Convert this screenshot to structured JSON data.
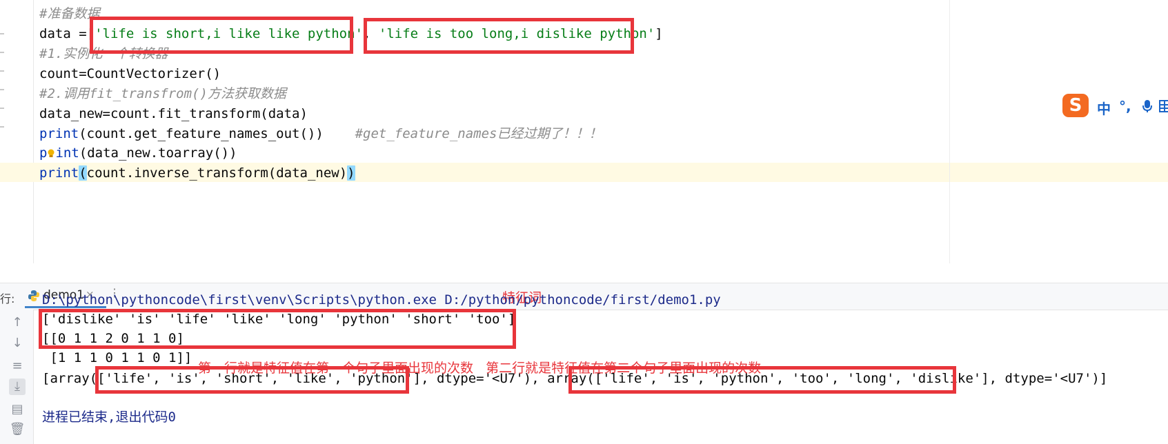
{
  "editor": {
    "lines": [
      {
        "comment": "#准备数据"
      },
      {
        "prefix": "data =[",
        "str1": "'life is short,i like like python'",
        "sep": ", ",
        "str2": "'life is too long,i dislike python'",
        "suffix": "]"
      },
      {
        "comment": "#1.实例化一个转换器"
      },
      {
        "code": "count=CountVectorizer()"
      },
      {
        "comment": "#2.调用fit_transfrom()方法获取数据"
      },
      {
        "code": "data_new=count.fit_transform(data)"
      },
      {
        "fn": "print",
        "code": "(count.get_feature_names_out())",
        "comment": "#get_feature_names已经过期了！！！"
      },
      {
        "fn_a": "p",
        "fn_b": "int",
        "code": "(data_new.toarray())"
      },
      {
        "fn": "print",
        "open": "(",
        "code": "count.inverse_transform(data_new)",
        "close": ")"
      }
    ]
  },
  "ime": {
    "logo": "S",
    "lang": "中",
    "punct": "°,",
    "mic": "mic-icon",
    "grid": "keyboard-icon"
  },
  "run_panel": {
    "label": "行:",
    "tab": "demo1",
    "close": "×",
    "options": "⋮",
    "annotation_title": "特征词",
    "output": [
      "D:\\python\\pythoncode\\first\\venv\\Scripts\\python.exe D:/python/pythoncode/first/demo1.py",
      "['dislike' 'is' 'life' 'like' 'long' 'python' 'short' 'too']",
      "[[0 1 1 2 0 1 1 0]",
      " [1 1 1 0 1 1 0 1]]",
      "[array(['life', 'is', 'short', 'like', 'python'], dtype='<U7'), array(['life', 'is', 'python', 'too', 'long', 'dislike'], dtype='<U7')]",
      "进程已结束,退出代码0"
    ],
    "annotation_note": "第一行就是特征值在第一个句子里面出现的次数   第二行就是特征值在第二个句子里面出现的次数"
  },
  "colors": {
    "annotation_red": "#e8353b",
    "string_green": "#067d17",
    "keyword_blue": "#0033b3",
    "comment_gray": "#8c8c8c"
  }
}
